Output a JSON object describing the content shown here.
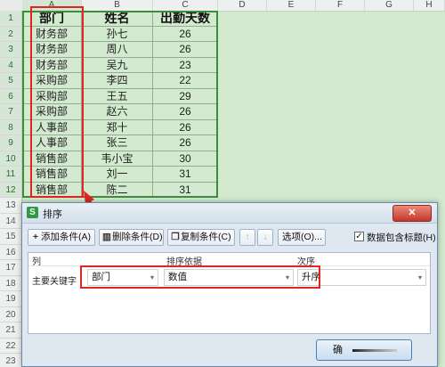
{
  "sheet": {
    "columns": [
      "A",
      "B",
      "C",
      "D",
      "E",
      "F",
      "G",
      "H"
    ],
    "rows": [
      "1",
      "2",
      "3",
      "4",
      "5",
      "6",
      "7",
      "8",
      "9",
      "10",
      "11",
      "12",
      "13",
      "14",
      "15",
      "16",
      "17",
      "18",
      "19",
      "20",
      "21",
      "22",
      "23"
    ],
    "headers": [
      "部门",
      "姓名",
      "出勤天数"
    ],
    "data": [
      [
        "财务部",
        "孙七",
        "26"
      ],
      [
        "财务部",
        "周八",
        "26"
      ],
      [
        "财务部",
        "吴九",
        "23"
      ],
      [
        "采购部",
        "李四",
        "22"
      ],
      [
        "采购部",
        "王五",
        "29"
      ],
      [
        "采购部",
        "赵六",
        "26"
      ],
      [
        "人事部",
        "郑十",
        "26"
      ],
      [
        "人事部",
        "张三",
        "26"
      ],
      [
        "销售部",
        "韦小宝",
        "30"
      ],
      [
        "销售部",
        "刘一",
        "31"
      ],
      [
        "销售部",
        "陈二",
        "31"
      ]
    ]
  },
  "dialog": {
    "title": "排序",
    "close_icon": "close-icon",
    "toolbar": {
      "add_label": "添加条件(A)",
      "delete_label": "删除条件(D)",
      "copy_label": "复制条件(C)",
      "up_arrow": "↑",
      "down_arrow": "↓",
      "options_label": "选项(O)...",
      "header_checkbox_label": "数据包含标题(H)",
      "header_checkbox_checked": true
    },
    "list": {
      "col_header": "列",
      "basis_header": "排序依据",
      "order_header": "次序",
      "row_label": "主要关键字",
      "column_value": "部门",
      "basis_value": "数值",
      "order_value": "升序"
    },
    "ok_label": "确"
  },
  "colors": {
    "accent_red": "#e0261e",
    "selection_green": "#3b8f3b",
    "cell_fill": "#d3ead0"
  }
}
